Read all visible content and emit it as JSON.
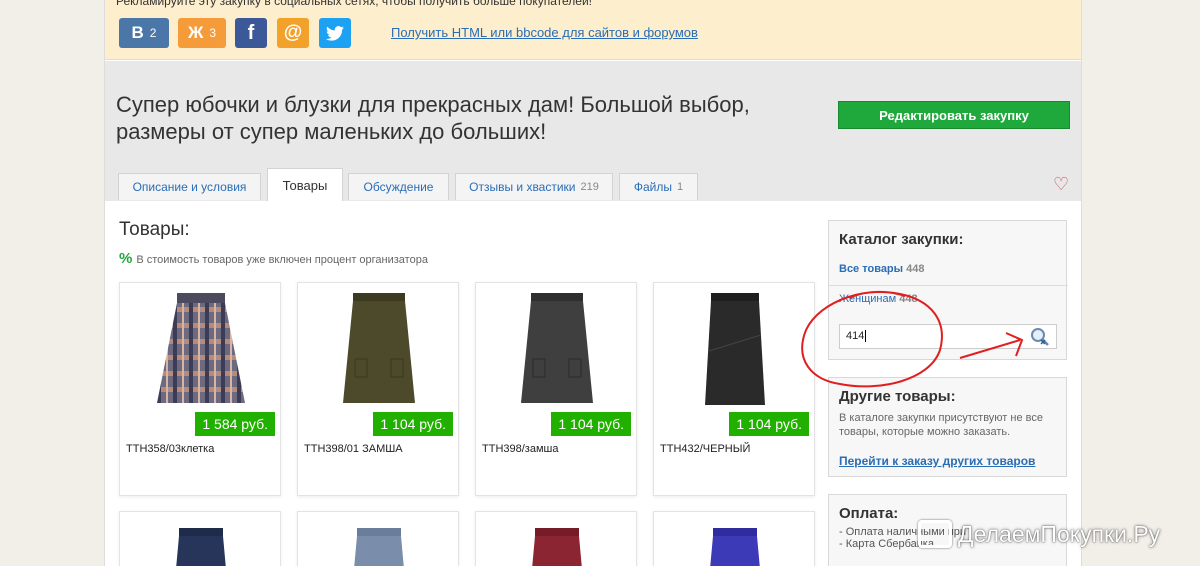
{
  "share": {
    "text": "Рекламируйте эту закупку в социальных сетях, чтобы получить больше покупателей!",
    "buttons": [
      {
        "icon": "vk-icon",
        "glyph": "B",
        "count": "2",
        "color": "#4a76a8"
      },
      {
        "icon": "odnoklassniki-icon",
        "glyph": "Ж",
        "count": "3",
        "color": "#f59b3a"
      },
      {
        "icon": "facebook-icon",
        "glyph": "f",
        "count": "",
        "color": "#3b5998"
      },
      {
        "icon": "mailru-icon",
        "glyph": "@",
        "count": "",
        "color": "#f2a22b"
      },
      {
        "icon": "twitter-icon",
        "glyph": "🐦",
        "count": "",
        "color": "#1da1f2"
      }
    ],
    "html_link": "Получить HTML или bbcode для сайтов и форумов"
  },
  "header": {
    "title": "Супер юбочки и блузки для прекрасных дам! Большой выбор, размеры от супер маленьких до больших!",
    "edit_button": "Редактировать закупку"
  },
  "tabs": [
    {
      "label": "Описание и условия",
      "count": ""
    },
    {
      "label": "Товары",
      "count": ""
    },
    {
      "label": "Обсуждение",
      "count": ""
    },
    {
      "label": "Отзывы и хвастики",
      "count": "219"
    },
    {
      "label": "Файлы",
      "count": "1"
    }
  ],
  "products": {
    "title": "Товары:",
    "note_symbol": "%",
    "note": "В стоимость товаров уже включен процент организатора",
    "items": [
      {
        "price": "1 584 руб.",
        "name": "ТТН358/03клетка",
        "color": "#5b5a6e"
      },
      {
        "price": "1 104 руб.",
        "name": "ТТН398/01 ЗАМША",
        "color": "#4d4a2c"
      },
      {
        "price": "1 104 руб.",
        "name": "ТТН398/замша",
        "color": "#3b3b3b"
      },
      {
        "price": "1 104 руб.",
        "name": "ТТН432/ЧЕРНЫЙ",
        "color": "#2a2a2a"
      },
      {
        "color": "#27355a"
      },
      {
        "color": "#7a8eab"
      },
      {
        "color": "#8c2532"
      },
      {
        "color": "#3d3ab8"
      }
    ]
  },
  "sidebar": {
    "catalog_title": "Каталог закупки:",
    "all_label": "Все товары",
    "all_count": "448",
    "women_label": "Женщинам",
    "women_count": "448",
    "search_value": "414",
    "other_title": "Другие товары:",
    "other_text": "В каталоге закупки присутствуют не все товары, которые можно заказать.",
    "other_link": "Перейти к заказу других товаров",
    "pay_title": "Оплата:",
    "pay_line1": "- Оплата наличными при",
    "pay_line2": "- Карта Сбербанка"
  },
  "watermark": "ДелаемПокупки.Ру"
}
